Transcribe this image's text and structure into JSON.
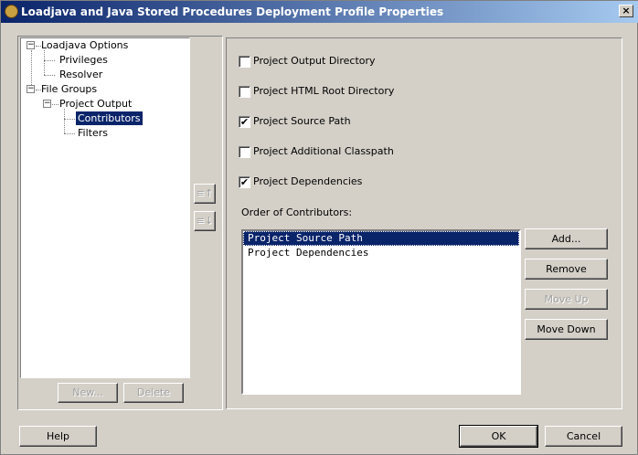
{
  "window": {
    "title": "Loadjava and Java Stored Procedures Deployment Profile Properties",
    "close": "×"
  },
  "tree": [
    {
      "label": "Loadjava Options",
      "expanded": true
    },
    {
      "label": "Privileges"
    },
    {
      "label": "Resolver"
    },
    {
      "label": "File Groups",
      "expanded": true
    },
    {
      "label": "Project Output",
      "expanded": true
    },
    {
      "label": "Contributors",
      "selected": true
    },
    {
      "label": "Filters"
    }
  ],
  "tree_buttons": {
    "new": "New...",
    "delete": "Delete"
  },
  "order_icons": {
    "up": "≡↑",
    "down": "≡↓"
  },
  "checkboxes": [
    {
      "label": "Project Output Directory",
      "checked": false
    },
    {
      "label": "Project HTML Root Directory",
      "checked": false
    },
    {
      "label": "Project Source Path",
      "checked": true
    },
    {
      "label": "Project Additional Classpath",
      "checked": false
    },
    {
      "label": "Project Dependencies",
      "checked": true
    }
  ],
  "check_mark": "✔",
  "order_label": "Order of Contributors:",
  "contributors": [
    "Project Source Path",
    "Project Dependencies"
  ],
  "list_buttons": {
    "add": "Add...",
    "remove": "Remove",
    "move_up": "Move Up",
    "move_down": "Move Down"
  },
  "footer": {
    "help": "Help",
    "ok": "OK",
    "cancel": "Cancel"
  }
}
